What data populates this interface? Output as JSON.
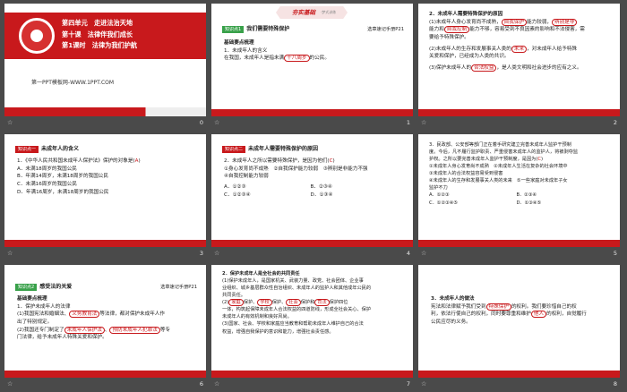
{
  "slides": [
    {
      "number": "0",
      "title1": "第四单元　走进法治天地",
      "title2": "第十课　法律伴我们成长",
      "title3": "第1课时　法律为我们护航",
      "footer": "第一PPT模板网-WWW.1PPT.COM"
    },
    {
      "number": "1",
      "banner": "夯实基础",
      "banner_sub": "·梦式训练",
      "tag": "知识点1",
      "heading": "我们需要特殊保护",
      "right": "选章速记手册P21",
      "subheading": "基础要点梳理",
      "item1": "1．未成年人的含义",
      "item1_text_pre": "在我国，未成年人是指未满",
      "item1_answer": "十八周岁",
      "item1_text_post": "的公民。"
    },
    {
      "number": "2",
      "heading": "2．未成年人需要特殊保护的原因",
      "l1_pre": "(1)未成年人身心发育尚不成熟，",
      "l1_a1": "自我保护",
      "l1_mid": "能力较弱，",
      "l1_a2": "辨别是非",
      "l2_pre": "能力和",
      "l2_a": "自我控制",
      "l2_post": "能力不够，容易受到不良因素的影响和不法侵害，需",
      "l3": "要给予特殊保护。",
      "l4": "(2)未成年人的生存和发展事关人类的",
      "l4_a": "未来",
      "l4_post": "，对未成年人给予特殊",
      "l5": "关爱和保护，已经成为人类的共识。",
      "l6_pre": "(3)保护未成年人的",
      "l6_a": "合法权益",
      "l6_post": "，是人类文明和社会进步的应有之义。"
    },
    {
      "number": "3",
      "tag": "知识点一",
      "heading": "未成年人的含义",
      "q": "1．《中华人民共和国未成年人保护法》保护的对象是(",
      "q_answer": "A",
      "q_end": ")",
      "a": "A．未满18周岁的我国公民",
      "b": "B．年满14周岁，未满18周岁的我国公民",
      "c": "C．未满16周岁的我国公民",
      "d": "D．年满16周岁，未满18周岁的我国公民"
    },
    {
      "number": "4",
      "tag": "知识点二",
      "heading": "未成年人需要特殊保护的原因",
      "q": "2．未成年人之所以需要特殊保护，是因为他们(",
      "q_answer": "C",
      "q_end": ")",
      "o1": "①身心发育尚不成熟",
      "o2": "②自我保护能力较弱",
      "o3": "③辨别是非能力不强",
      "o4": "④自我控制能力较弱",
      "a": "A．①②③",
      "b": "B．②③④",
      "c": "C．①②③④",
      "d": "D．①③④"
    },
    {
      "number": "5",
      "l1": "3．民政部、公安部等部门正在着手研究建立完善未成年人监护干预制",
      "l2": "度。今后，凡不履行监护职责、严重侵害未成年人的监护人，将被剥夺监",
      "l3": "护权。之所以要完善未成年人监护干预制度，是因为(",
      "q_answer": "C",
      "l3_end": ")",
      "o1": "①未成年人身心发育尚不成熟",
      "o2": "②未成年人生活在复杂的社会环境中",
      "o3": "③未成年人的合法权益容易受",
      "o3b": "到侵害",
      "o4": "④未成年人的生存和发展事关人类的未来",
      "o5": "⑤一些家庭对未成年子女",
      "o5b": "监护不力",
      "a": "A．①②③",
      "b": "B．②③④",
      "c": "C．①②③④⑤",
      "d": "D．①③④⑤"
    },
    {
      "number": "6",
      "tag": "知识点2",
      "heading": "感受法的关爱",
      "right": "选章速记手册P21",
      "subheading": "基础要点梳理",
      "item": "1．保护未成年人的法律",
      "l1_pre": "(1)我国宪法和婚姻法、",
      "l1_a": "义务教育法",
      "l1_post": "等法律，都对保护未成年人作",
      "l2": "出了特别规定。",
      "l3_pre": "(2)我国还专门制定了",
      "l3_a1": "未成年人保护法",
      "l3_mid": "、",
      "l3_a2": "预防未成年人犯罪法",
      "l3_post": "等专",
      "l4": "门法律，给予未成年人特殊关爱和保护。"
    },
    {
      "number": "7",
      "heading": "2．保护未成年人是全社会的共同责任",
      "l1": "(1)保护未成年人，是国家机关、武装力量、政党、社会团体、企业事",
      "l2": "业组织、城乡基层群众性自治组织、未成年人的监护人和其他成年公民的",
      "l3": "共同责任。",
      "l4_pre": "(2)",
      "a1": "家庭",
      "s1": "保护、",
      "a2": "学校",
      "s2": "保护、",
      "a3": "社会",
      "s3": "保护和",
      "a4": "司法",
      "s4": "保护四位",
      "l5": "一体，构筑起保障未成年人合法权益的四道防线，形成全社会关心、保护",
      "l6": "未成年人的有效机制和良好风尚。",
      "l7": "(3)国家、社会、学校和家庭应当教育和帮助未成年人维护自己的合法",
      "l8": "权益，增强自我保护的意识和能力，增强社会责任感。"
    },
    {
      "number": "8",
      "heading": "3．未成年人的做法",
      "l1_pre": "宪法和法律赋予我们受到",
      "l1_a": "特殊保护",
      "l1_post": "的权利。我们要珍惜自己的权",
      "l2_pre": "利，依法行使自己的权利，同时要尊重和维护",
      "l2_a": "他人",
      "l2_post": "的权利，自觉履行",
      "l3": "公民应尽的义务。"
    }
  ]
}
